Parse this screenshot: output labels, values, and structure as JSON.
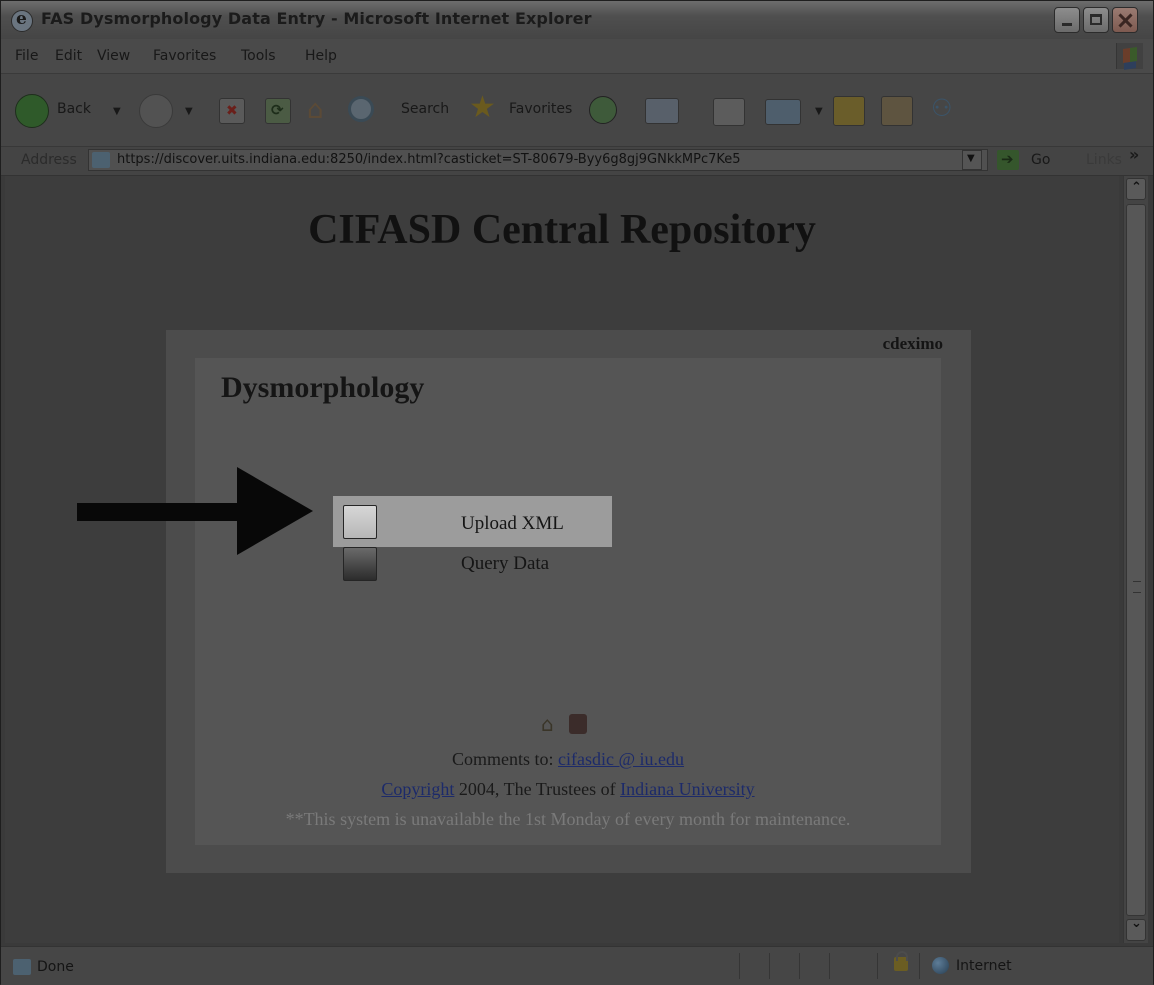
{
  "window": {
    "title": "FAS Dysmorphology Data Entry - Microsoft Internet Explorer"
  },
  "menu": [
    "File",
    "Edit",
    "View",
    "Favorites",
    "Tools",
    "Help"
  ],
  "toolbar": {
    "back": "Back",
    "search": "Search",
    "favorites": "Favorites"
  },
  "address": {
    "label": "Address",
    "url": "https://discover.uits.indiana.edu:8250/index.html?casticket=ST-80679-Byy6g8gj9GNkkMPc7Ke5",
    "go": "Go",
    "links": "Links",
    "links_more": "»"
  },
  "page": {
    "title": "CIFASD Central Repository",
    "username": "cdeximo",
    "section_title": "Dysmorphology",
    "options": {
      "upload": "Upload XML",
      "query": "Query Data"
    },
    "footer": {
      "comments_prefix": "Comments to: ",
      "comments_email": "cifasdic @ iu.edu",
      "copyright_link": "Copyright",
      "copyright_text": " 2004, The Trustees of ",
      "university_link": "Indiana University",
      "maintenance": "**This system is unavailable the 1st Monday of every month for maintenance."
    }
  },
  "status": {
    "text": "Done",
    "zone": "Internet"
  }
}
